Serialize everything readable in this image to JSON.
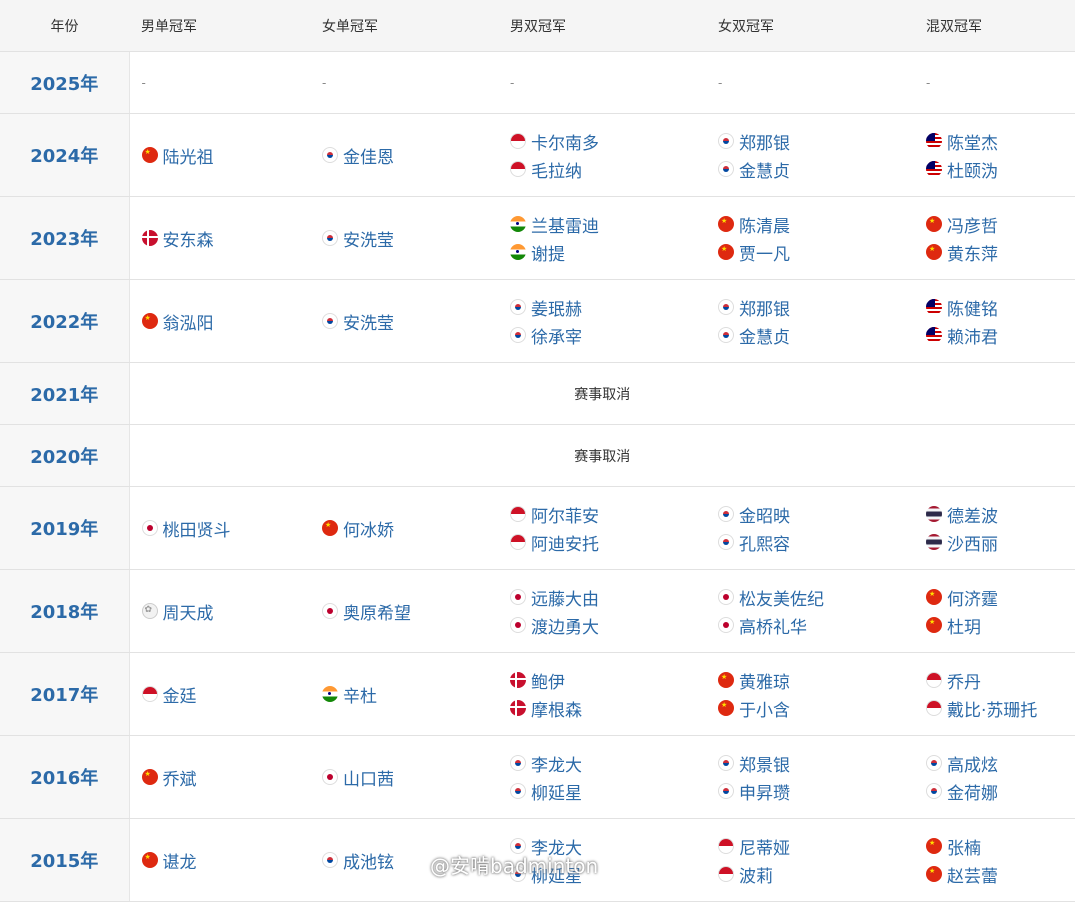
{
  "header": {
    "year": "年份",
    "ms": "男单冠军",
    "ws": "女单冠军",
    "md": "男双冠军",
    "wd": "女双冠军",
    "xd": "混双冠军"
  },
  "rows": [
    {
      "year": "2025年",
      "type": "dash",
      "dash": "-"
    },
    {
      "year": "2024年",
      "type": "data",
      "ms": [
        {
          "flag": "cn",
          "name": "陆光祖"
        }
      ],
      "ws": [
        {
          "flag": "kr",
          "name": "金佳恩"
        }
      ],
      "md": [
        {
          "flag": "id",
          "name": "卡尔南多"
        },
        {
          "flag": "id",
          "name": "毛拉纳"
        }
      ],
      "wd": [
        {
          "flag": "kr",
          "name": "郑那银"
        },
        {
          "flag": "kr",
          "name": "金慧贞"
        }
      ],
      "xd": [
        {
          "flag": "my",
          "name": "陈堂杰"
        },
        {
          "flag": "my",
          "name": "杜颐沩"
        }
      ]
    },
    {
      "year": "2023年",
      "type": "data",
      "ms": [
        {
          "flag": "dk",
          "name": "安东森"
        }
      ],
      "ws": [
        {
          "flag": "kr",
          "name": "安洗莹"
        }
      ],
      "md": [
        {
          "flag": "in",
          "name": "兰基雷迪"
        },
        {
          "flag": "in",
          "name": "谢提"
        }
      ],
      "wd": [
        {
          "flag": "cn",
          "name": "陈清晨"
        },
        {
          "flag": "cn",
          "name": "贾一凡"
        }
      ],
      "xd": [
        {
          "flag": "cn",
          "name": "冯彦哲"
        },
        {
          "flag": "cn",
          "name": "黄东萍"
        }
      ]
    },
    {
      "year": "2022年",
      "type": "data",
      "ms": [
        {
          "flag": "cn",
          "name": "翁泓阳"
        }
      ],
      "ws": [
        {
          "flag": "kr",
          "name": "安洗莹"
        }
      ],
      "md": [
        {
          "flag": "kr",
          "name": "姜珉赫"
        },
        {
          "flag": "kr",
          "name": "徐承宰"
        }
      ],
      "wd": [
        {
          "flag": "kr",
          "name": "郑那银"
        },
        {
          "flag": "kr",
          "name": "金慧贞"
        }
      ],
      "xd": [
        {
          "flag": "my",
          "name": "陈健铭"
        },
        {
          "flag": "my",
          "name": "赖沛君"
        }
      ]
    },
    {
      "year": "2021年",
      "type": "cancel",
      "text": "赛事取消"
    },
    {
      "year": "2020年",
      "type": "cancel",
      "text": "赛事取消"
    },
    {
      "year": "2019年",
      "type": "data",
      "ms": [
        {
          "flag": "jp",
          "name": "桃田贤斗"
        }
      ],
      "ws": [
        {
          "flag": "cn",
          "name": "何冰娇"
        }
      ],
      "md": [
        {
          "flag": "id",
          "name": "阿尔菲安"
        },
        {
          "flag": "id",
          "name": "阿迪安托"
        }
      ],
      "wd": [
        {
          "flag": "kr",
          "name": "金昭映"
        },
        {
          "flag": "kr",
          "name": "孔熙容"
        }
      ],
      "xd": [
        {
          "flag": "th",
          "name": "德差波"
        },
        {
          "flag": "th",
          "name": "沙西丽"
        }
      ]
    },
    {
      "year": "2018年",
      "type": "data",
      "ms": [
        {
          "flag": "hk",
          "name": "周天成"
        }
      ],
      "ws": [
        {
          "flag": "jp",
          "name": "奥原希望"
        }
      ],
      "md": [
        {
          "flag": "jp",
          "name": "远藤大由"
        },
        {
          "flag": "jp",
          "name": "渡边勇大"
        }
      ],
      "wd": [
        {
          "flag": "jp",
          "name": "松友美佐纪"
        },
        {
          "flag": "jp",
          "name": "高桥礼华"
        }
      ],
      "xd": [
        {
          "flag": "cn",
          "name": "何济霆"
        },
        {
          "flag": "cn",
          "name": "杜玥"
        }
      ]
    },
    {
      "year": "2017年",
      "type": "data",
      "ms": [
        {
          "flag": "id",
          "name": "金廷"
        }
      ],
      "ws": [
        {
          "flag": "in",
          "name": "辛杜"
        }
      ],
      "md": [
        {
          "flag": "dk",
          "name": "鲍伊"
        },
        {
          "flag": "dk",
          "name": "摩根森"
        }
      ],
      "wd": [
        {
          "flag": "cn",
          "name": "黄雅琼"
        },
        {
          "flag": "cn",
          "name": "于小含"
        }
      ],
      "xd": [
        {
          "flag": "id",
          "name": "乔丹"
        },
        {
          "flag": "id",
          "name": "戴比·苏珊托"
        }
      ]
    },
    {
      "year": "2016年",
      "type": "data",
      "ms": [
        {
          "flag": "cn",
          "name": "乔斌"
        }
      ],
      "ws": [
        {
          "flag": "jp",
          "name": "山口茜"
        }
      ],
      "md": [
        {
          "flag": "kr",
          "name": "李龙大"
        },
        {
          "flag": "kr",
          "name": "柳延星"
        }
      ],
      "wd": [
        {
          "flag": "kr",
          "name": "郑景银"
        },
        {
          "flag": "kr",
          "name": "申昇瓒"
        }
      ],
      "xd": [
        {
          "flag": "kr",
          "name": "高成炫"
        },
        {
          "flag": "kr",
          "name": "金荷娜"
        }
      ]
    },
    {
      "year": "2015年",
      "type": "data",
      "ms": [
        {
          "flag": "cn",
          "name": "谌龙"
        }
      ],
      "ws": [
        {
          "flag": "kr",
          "name": "成池铉"
        }
      ],
      "md": [
        {
          "flag": "kr",
          "name": "李龙大"
        },
        {
          "flag": "kr",
          "name": "柳延星"
        }
      ],
      "wd": [
        {
          "flag": "id",
          "name": "尼蒂娅"
        },
        {
          "flag": "id",
          "name": "波莉"
        }
      ],
      "xd": [
        {
          "flag": "cn",
          "name": "张楠"
        },
        {
          "flag": "cn",
          "name": "赵芸蕾"
        }
      ]
    }
  ],
  "watermark": "@安啃badminton"
}
